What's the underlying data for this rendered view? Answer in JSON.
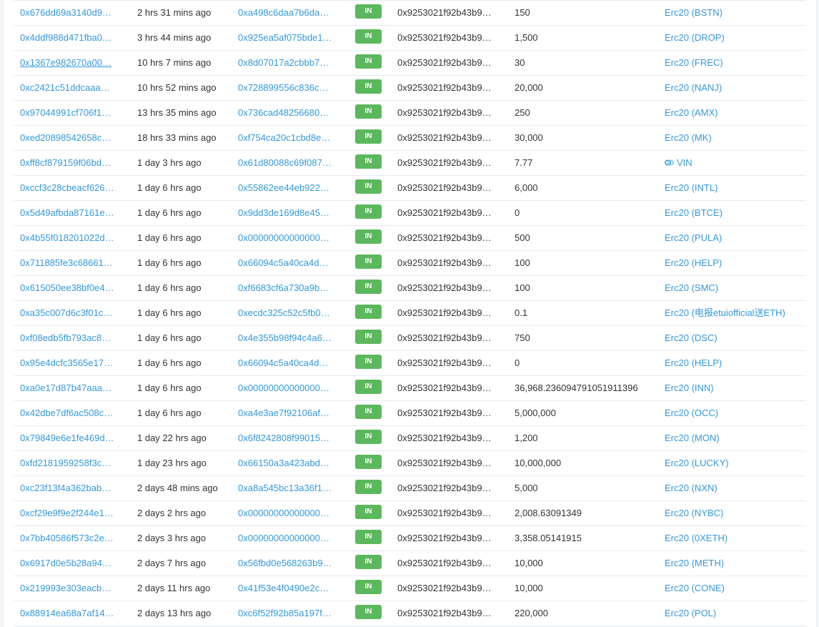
{
  "transactions": [
    {
      "hash": "0x676dd69a3140d9…",
      "age": "2 hrs 31 mins ago",
      "from": "0xa498c6daa7b6da…",
      "direction": "IN",
      "to": "0x9253021f92b43b9…",
      "value": "150",
      "token": "Erc20 (BSTN)"
    },
    {
      "hash": "0x4ddf988d471fba0…",
      "age": "3 hrs 44 mins ago",
      "from": "0x925ea5af075bde1…",
      "direction": "IN",
      "to": "0x9253021f92b43b9…",
      "value": "1,500",
      "token": "Erc20 (DROP)"
    },
    {
      "hash": "0x1367e982670a00…",
      "age": "10 hrs 7 mins ago",
      "from": "0x8d07017a2cbbb7…",
      "direction": "IN",
      "to": "0x9253021f92b43b9…",
      "value": "30",
      "token": "Erc20 (FREC)"
    },
    {
      "hash": "0xc2421c51ddcaaa…",
      "age": "10 hrs 52 mins ago",
      "from": "0x728899556c836c…",
      "direction": "IN",
      "to": "0x9253021f92b43b9…",
      "value": "20,000",
      "token": "Erc20 (NANJ)"
    },
    {
      "hash": "0x97044991cf706f1…",
      "age": "13 hrs 35 mins ago",
      "from": "0x736cad48256680…",
      "direction": "IN",
      "to": "0x9253021f92b43b9…",
      "value": "250",
      "token": "Erc20 (AMX)"
    },
    {
      "hash": "0xed20898542658c…",
      "age": "18 hrs 33 mins ago",
      "from": "0xf754ca20c1cbd8e…",
      "direction": "IN",
      "to": "0x9253021f92b43b9…",
      "value": "30,000",
      "token": "Erc20 (MK)"
    },
    {
      "hash": "0xff8cf879159f06bd…",
      "age": "1 day 3 hrs ago",
      "from": "0x61d80088c69f087…",
      "direction": "IN",
      "to": "0x9253021f92b43b9…",
      "value": "7.77",
      "token": "VIN"
    },
    {
      "hash": "0xccf3c28cbeacf626…",
      "age": "1 day 6 hrs ago",
      "from": "0x55862ee44eb922…",
      "direction": "IN",
      "to": "0x9253021f92b43b9…",
      "value": "6,000",
      "token": "Erc20 (INTL)"
    },
    {
      "hash": "0x5d49afbda87161e…",
      "age": "1 day 6 hrs ago",
      "from": "0x9dd3de169d8e45…",
      "direction": "IN",
      "to": "0x9253021f92b43b9…",
      "value": "0",
      "token": "Erc20 (BTCE)"
    },
    {
      "hash": "0x4b55f018201022d…",
      "age": "1 day 6 hrs ago",
      "from": "0x00000000000000…",
      "direction": "IN",
      "to": "0x9253021f92b43b9…",
      "value": "500",
      "token": "Erc20 (PULA)"
    },
    {
      "hash": "0x711885fe3c68661…",
      "age": "1 day 6 hrs ago",
      "from": "0x66094c5a40ca4d…",
      "direction": "IN",
      "to": "0x9253021f92b43b9…",
      "value": "100",
      "token": "Erc20 (HELP)"
    },
    {
      "hash": "0x615050ee38bf0e4…",
      "age": "1 day 6 hrs ago",
      "from": "0xf6683cf6a730a9b…",
      "direction": "IN",
      "to": "0x9253021f92b43b9…",
      "value": "100",
      "token": "Erc20 (SMC)"
    },
    {
      "hash": "0xa35c007d6c3f01c…",
      "age": "1 day 6 hrs ago",
      "from": "0xecdc325c52c5fb0…",
      "direction": "IN",
      "to": "0x9253021f92b43b9…",
      "value": "0.1",
      "token": "Erc20 (电报etuiofficial送ETH)"
    },
    {
      "hash": "0xf08edb5fb793ac8…",
      "age": "1 day 6 hrs ago",
      "from": "0x4e355b98f94c4a6…",
      "direction": "IN",
      "to": "0x9253021f92b43b9…",
      "value": "750",
      "token": "Erc20 (DSC)"
    },
    {
      "hash": "0x95e4dcfc3565e17…",
      "age": "1 day 6 hrs ago",
      "from": "0x66094c5a40ca4d…",
      "direction": "IN",
      "to": "0x9253021f92b43b9…",
      "value": "0",
      "token": "Erc20 (HELP)"
    },
    {
      "hash": "0xa0e17d87b47aaa…",
      "age": "1 day 6 hrs ago",
      "from": "0x00000000000000…",
      "direction": "IN",
      "to": "0x9253021f92b43b9…",
      "value": "36,968.236094791051911396",
      "token": "Erc20 (INN)"
    },
    {
      "hash": "0x42dbe7df6ac508c…",
      "age": "1 day 6 hrs ago",
      "from": "0xa4e3ae7f92106af…",
      "direction": "IN",
      "to": "0x9253021f92b43b9…",
      "value": "5,000,000",
      "token": "Erc20 (OCC)"
    },
    {
      "hash": "0x79849e6e1fe469d…",
      "age": "1 day 22 hrs ago",
      "from": "0x6f8242808f99015…",
      "direction": "IN",
      "to": "0x9253021f92b43b9…",
      "value": "1,200",
      "token": "Erc20 (MON)"
    },
    {
      "hash": "0xfd2181959258f3c…",
      "age": "1 day 23 hrs ago",
      "from": "0x66150a3a423abd…",
      "direction": "IN",
      "to": "0x9253021f92b43b9…",
      "value": "10,000,000",
      "token": "Erc20 (LUCKY)"
    },
    {
      "hash": "0xc23f13f4a362bab…",
      "age": "2 days 48 mins ago",
      "from": "0xa8a545bc13a36f1…",
      "direction": "IN",
      "to": "0x9253021f92b43b9…",
      "value": "5,000",
      "token": "Erc20 (NXN)"
    },
    {
      "hash": "0xcf29e9f9e2f244e1…",
      "age": "2 days 2 hrs ago",
      "from": "0x00000000000000…",
      "direction": "IN",
      "to": "0x9253021f92b43b9…",
      "value": "2,008.63091349",
      "token": "Erc20 (NYBC)"
    },
    {
      "hash": "0x7bb40586f573c2e…",
      "age": "2 days 3 hrs ago",
      "from": "0x00000000000000…",
      "direction": "IN",
      "to": "0x9253021f92b43b9…",
      "value": "3,358.05141915",
      "token": "Erc20 (0XETH)"
    },
    {
      "hash": "0x6917d0e5b28a94…",
      "age": "2 days 7 hrs ago",
      "from": "0x56fbd0e568263b9…",
      "direction": "IN",
      "to": "0x9253021f92b43b9…",
      "value": "10,000",
      "token": "Erc20 (METH)"
    },
    {
      "hash": "0x219993e303eacb…",
      "age": "2 days 11 hrs ago",
      "from": "0x41f53e4f0490e2c…",
      "direction": "IN",
      "to": "0x9253021f92b43b9…",
      "value": "10,000",
      "token": "Erc20 (CONE)"
    },
    {
      "hash": "0x88914ea68a7af14…",
      "age": "2 days 13 hrs ago",
      "from": "0xc6f52f92b85a197f…",
      "direction": "IN",
      "to": "0x9253021f92b43b9…",
      "value": "220,000",
      "token": "Erc20 (POL)"
    }
  ],
  "token_icons": {
    "6": "vin-token-icon"
  },
  "hovered_row": 2,
  "colors": {
    "link": "#3498db",
    "badge_in": "#5cb85c",
    "border": "#e7eaf3",
    "text": "#333333"
  }
}
